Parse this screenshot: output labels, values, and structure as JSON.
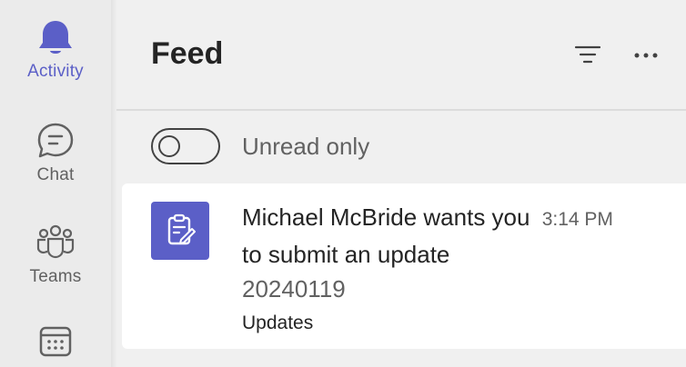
{
  "rail": {
    "items": [
      {
        "label": "Activity",
        "icon": "bell-icon",
        "active": true
      },
      {
        "label": "Chat",
        "icon": "chat-icon"
      },
      {
        "label": "Teams",
        "icon": "teams-icon"
      },
      {
        "label": "",
        "icon": "calendar-icon"
      }
    ]
  },
  "header": {
    "title": "Feed",
    "filter_icon": "filter-icon",
    "more_icon": "more-icon"
  },
  "toggle": {
    "label": "Unread only",
    "on": false
  },
  "feed": {
    "items": [
      {
        "title_part1": "Michael McBride wants you",
        "time": "3:14 PM",
        "title_part2": "to submit an update",
        "subtitle": "20240119",
        "source": "Updates",
        "icon": "clipboard-edit-icon"
      }
    ]
  },
  "colors": {
    "accent": "#5b5fc7",
    "text": "#242424",
    "muted": "#616161",
    "background": "#f0f0f0",
    "card": "#ffffff"
  }
}
